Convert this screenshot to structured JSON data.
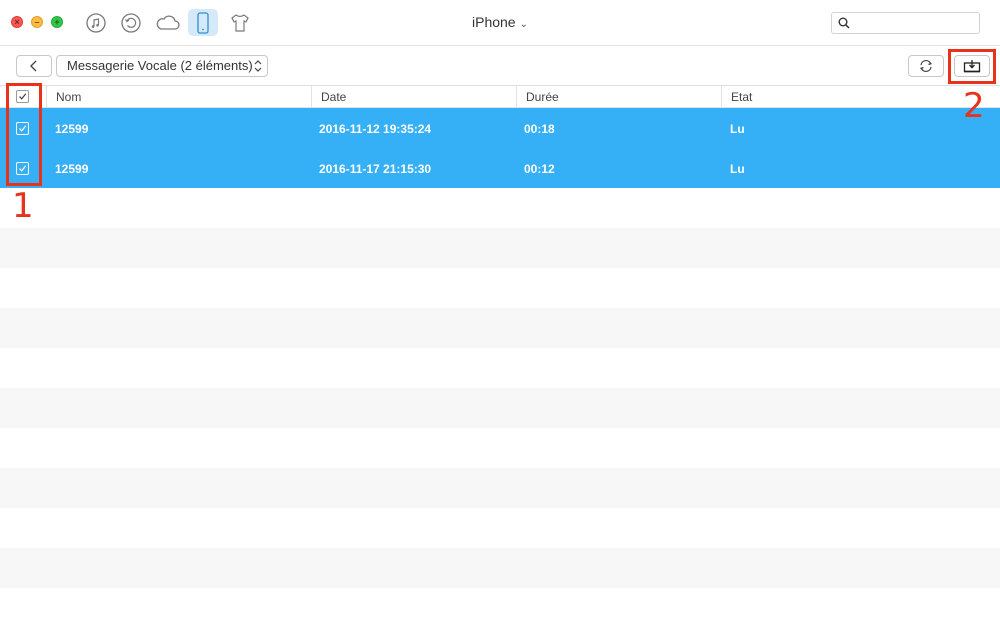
{
  "window": {
    "device_title": "iPhone",
    "toolbar_icons": [
      "music-icon",
      "restore-icon",
      "cloud-icon",
      "phone-icon",
      "shirt-icon"
    ],
    "active_icon": "phone-icon",
    "search": {
      "placeholder": "",
      "value": ""
    }
  },
  "toolbar": {
    "category_label": "Messagerie Vocale (2 éléments)",
    "back_icon": "chevron-left-icon",
    "refresh_icon": "refresh-icon",
    "export_icon": "export-to-computer-icon"
  },
  "table": {
    "columns": [
      "Nom",
      "Date",
      "Durée",
      "Etat"
    ],
    "select_all_checked": true,
    "rows": [
      {
        "checked": true,
        "nom": "12599",
        "date": "2016-11-12 19:35:24",
        "duree": "00:18",
        "etat": "Lu"
      },
      {
        "checked": true,
        "nom": "12599",
        "date": "2016-11-17 21:15:30",
        "duree": "00:12",
        "etat": "Lu"
      }
    ]
  },
  "annotations": {
    "label_1": "1",
    "label_2": "2"
  },
  "colors": {
    "selection": "#35aff5",
    "annotation": "#e8321b",
    "active_tab": "#d6e9f8"
  }
}
